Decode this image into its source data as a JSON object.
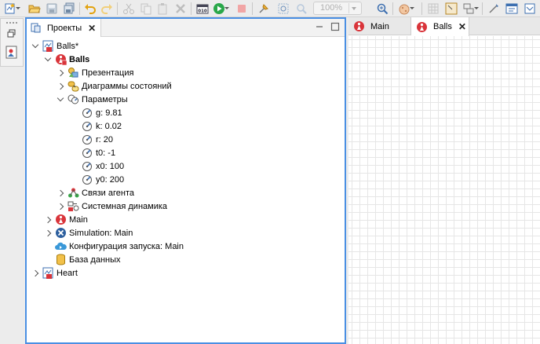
{
  "toolbar": {
    "zoom_value": "100%"
  },
  "projects_view": {
    "tab_label": "Проекты",
    "close_symbol": "✕"
  },
  "tree": {
    "balls_project": "Balls*",
    "balls_agent": "Balls",
    "presentation": "Презентация",
    "statecharts": "Диаграммы состояний",
    "parameters": "Параметры",
    "params": [
      "g: 9.81",
      "k: 0.02",
      "r: 20",
      "t0: -1",
      "x0: 100",
      "y0: 200"
    ],
    "agent_links": "Связи агента",
    "system_dynamics": "Системная динамика",
    "main": "Main",
    "simulation": "Simulation: Main",
    "run_config": "Конфигурация запуска: Main",
    "database": "База данных",
    "heart_project": "Heart"
  },
  "editor": {
    "tabs": [
      "Main",
      "Balls"
    ],
    "active_tab": "Balls",
    "close_symbol": "✕"
  },
  "colors": {
    "focus_border": "#4a8fe3",
    "agent_red": "#d9343a",
    "grid_line": "#e6e6e6"
  }
}
